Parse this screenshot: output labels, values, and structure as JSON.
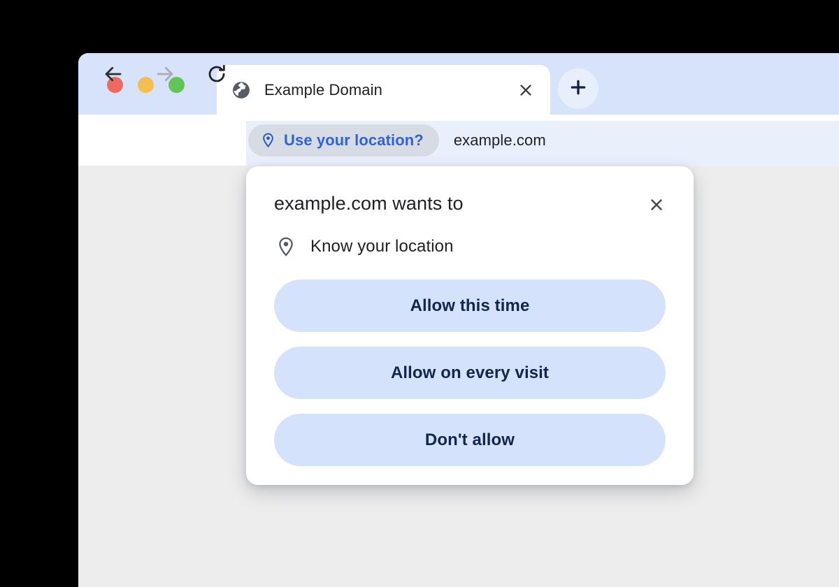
{
  "window": {
    "controls": [
      {
        "name": "close",
        "color": "#ec6a5e"
      },
      {
        "name": "minimize",
        "color": "#f3bf4f"
      },
      {
        "name": "maximize",
        "color": "#61c454"
      }
    ]
  },
  "tab_strip": {
    "active_tab": {
      "title": "Example Domain",
      "favicon": "globe-icon",
      "close_icon": "close-icon"
    },
    "new_tab_button": {
      "icon": "plus-icon",
      "label": "+"
    }
  },
  "toolbar": {
    "back_icon": "arrow-left-icon",
    "forward_icon": "arrow-right-icon",
    "reload_icon": "reload-icon",
    "permission_chip": {
      "icon": "location-pin-icon",
      "label": "Use your location?"
    },
    "url": "example.com"
  },
  "dialog": {
    "title": "example.com wants to",
    "close_icon": "close-icon",
    "permission": {
      "icon": "location-pin-icon",
      "label": "Know your location"
    },
    "actions": [
      {
        "label": "Allow this time"
      },
      {
        "label": "Allow on every visit"
      },
      {
        "label": "Don't allow"
      }
    ]
  },
  "colors": {
    "page_background": "#000000",
    "tab_strip": "#d7e3fb",
    "toolbar": "#eaeffc",
    "viewport": "#ededed",
    "chip_background": "#d7dce4",
    "chip_text": "#2f63d6",
    "button_background": "#d5e2fb",
    "button_text": "#11254f"
  }
}
